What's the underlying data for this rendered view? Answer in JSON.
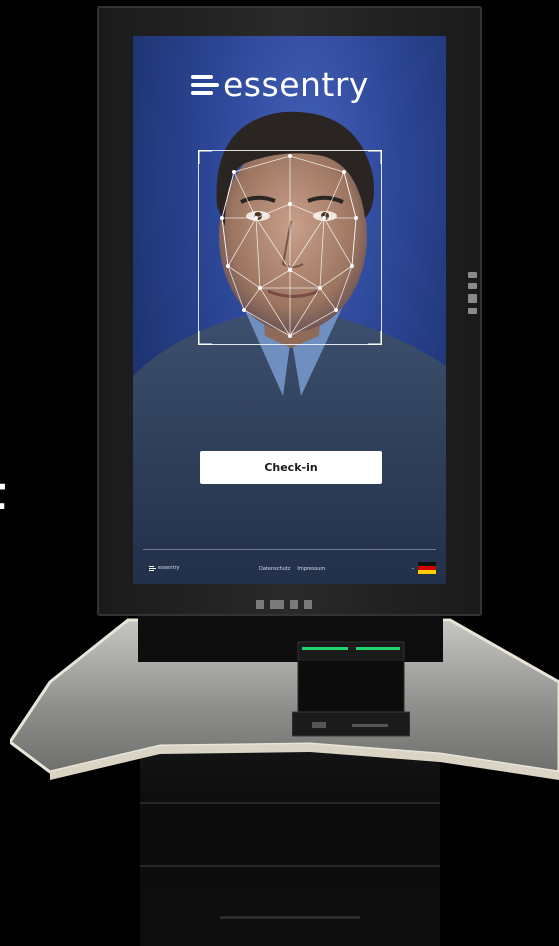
{
  "brand": {
    "name": "essentry",
    "accent": "#2c4696"
  },
  "edge_text": "t",
  "screen": {
    "checkin_label": "Check-in",
    "footer": {
      "brand": "essentry",
      "links": [
        "Datenschutz",
        "Impressum"
      ],
      "language_chevron": "⌄",
      "language_flag_icon": "flag-germany-icon"
    }
  },
  "colors": {
    "flag": [
      "#111111",
      "#d40000",
      "#ffcc00"
    ],
    "scanner_led": "#21d46a",
    "desk_top": "#9a9a98",
    "desk_edge": "#e8e4d8"
  },
  "icons": [
    "essentry-logo-icon",
    "face-mesh-icon",
    "flag-germany-icon"
  ]
}
